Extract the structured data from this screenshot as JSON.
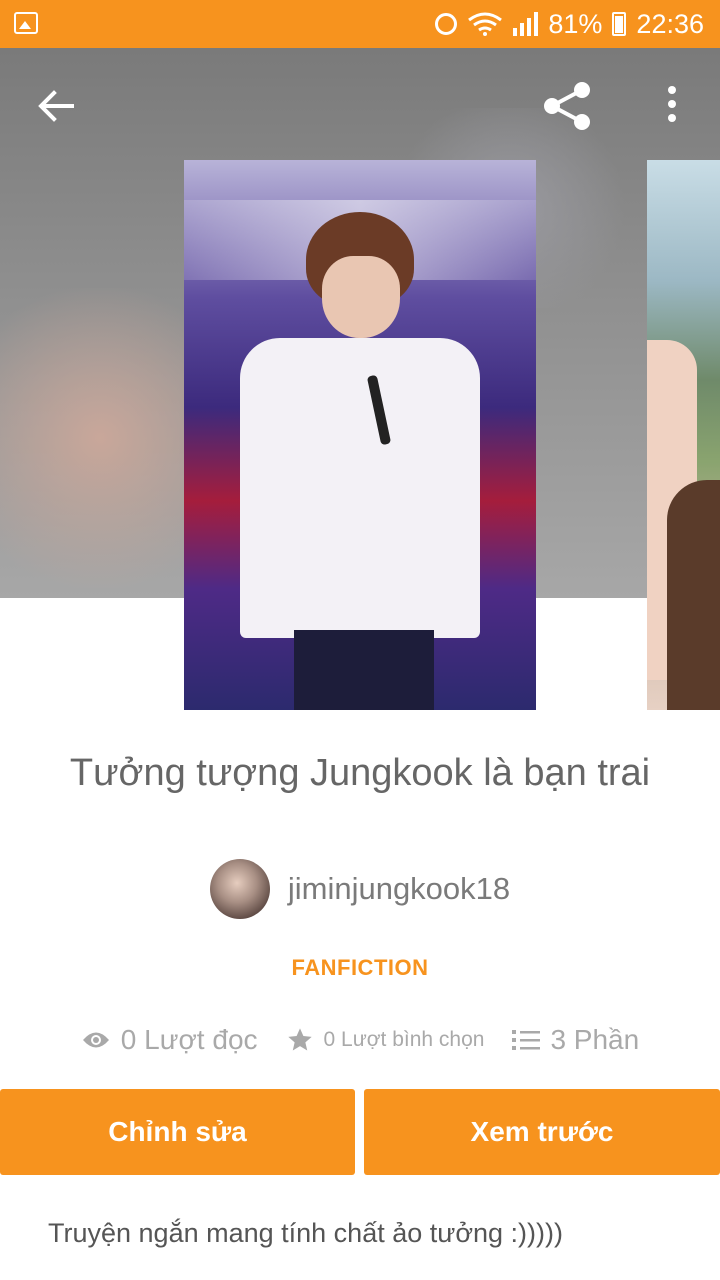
{
  "status_bar": {
    "battery": "81%",
    "time": "22:36"
  },
  "toolbar": {
    "back_icon": "arrow-left-icon",
    "share_icon": "share-icon",
    "more_icon": "more-vertical-icon"
  },
  "story": {
    "title": "Tưởng tượng Jungkook là bạn trai",
    "author": "jiminjungkook18",
    "category": "FANFICTION",
    "reads": "0 Lượt đọc",
    "votes": "0 Lượt bình chọn",
    "parts": "3 Phần",
    "description": "Truyện ngắn mang tính chất ảo tưởng :)))))"
  },
  "actions": {
    "edit_label": "Chỉnh sửa",
    "preview_label": "Xem trước"
  },
  "colors": {
    "accent": "#f7931e",
    "text_gray": "#666666",
    "stat_gray": "#a9a9a9"
  }
}
